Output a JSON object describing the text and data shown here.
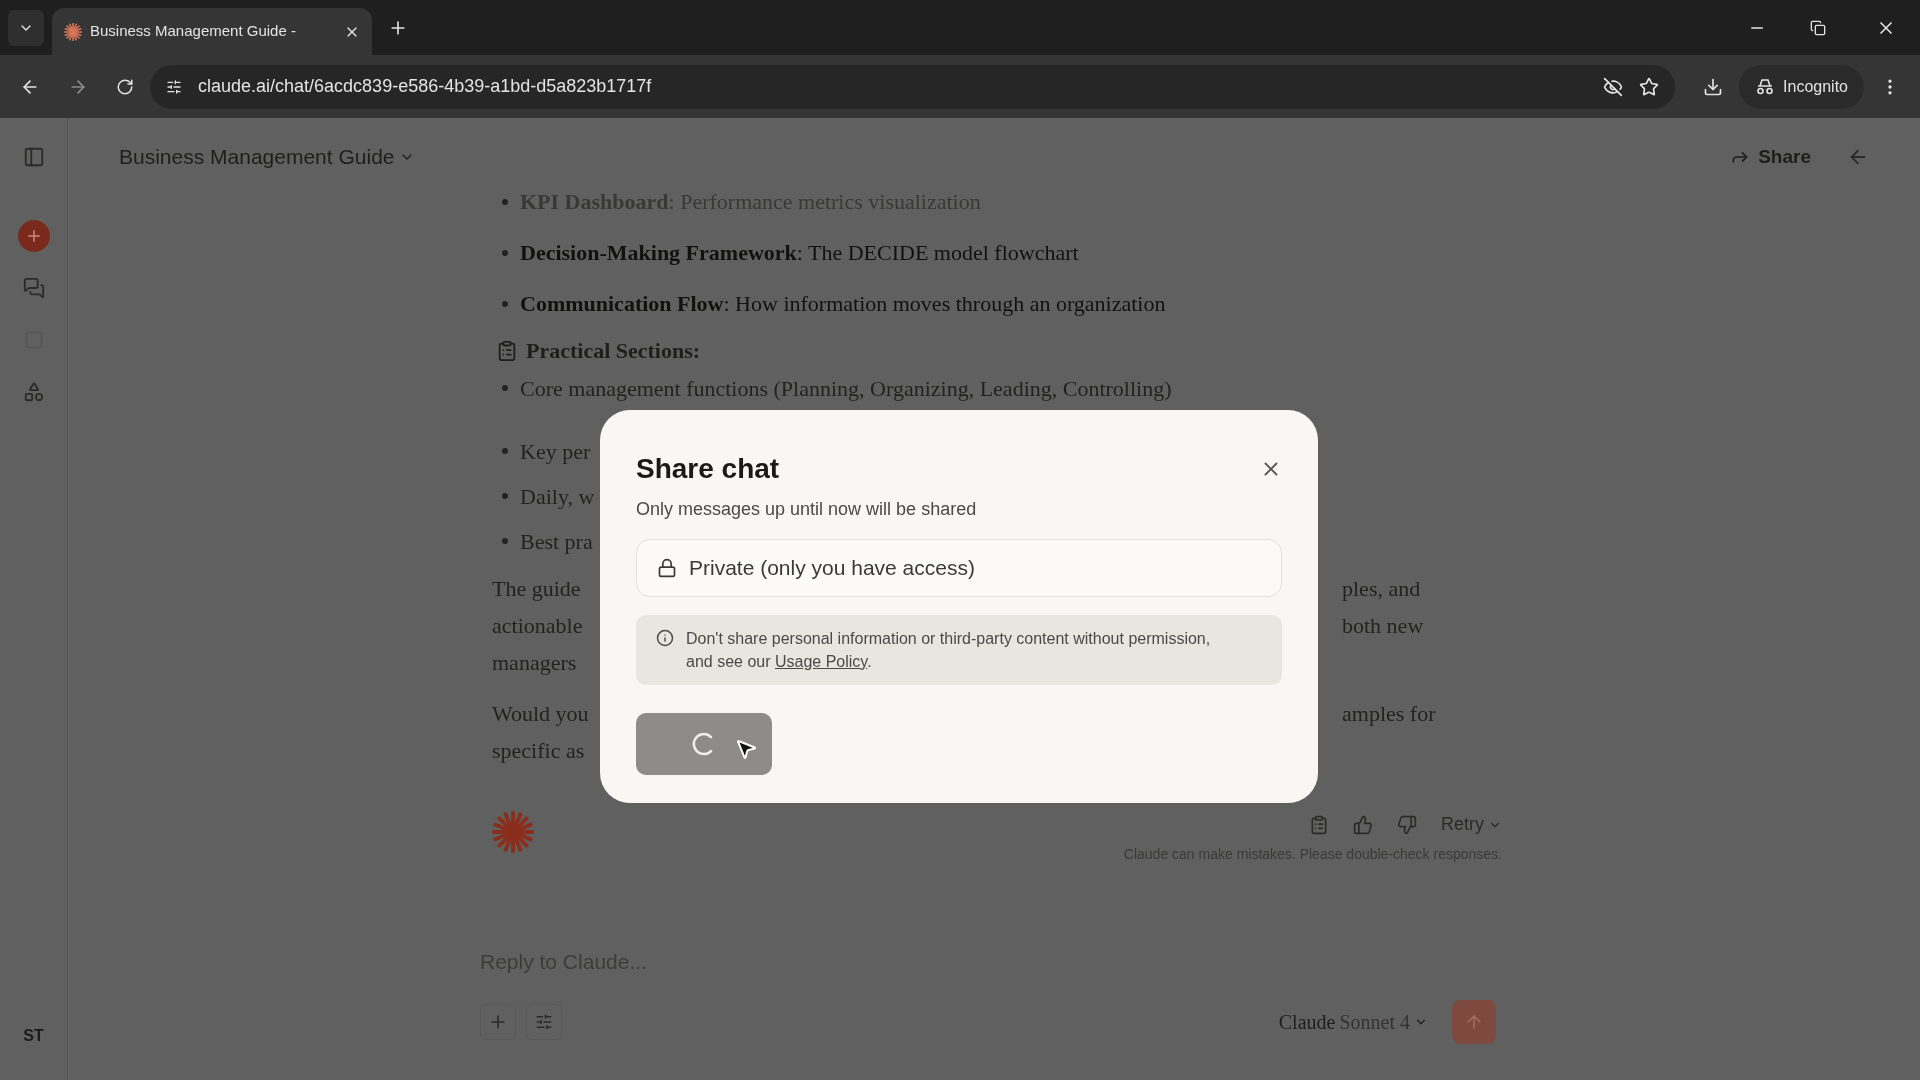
{
  "browser": {
    "tab_title": "Business Management Guide -",
    "url": "claude.ai/chat/6acdc839-e586-4b39-a1bd-d5a823b1717f",
    "profile": "Incognito"
  },
  "header": {
    "title": "Business Management Guide",
    "share": "Share"
  },
  "sidebar": {
    "avatar": "ST"
  },
  "message": {
    "bullets": [
      {
        "bold": "KPI Dashboard",
        "text": ": Performance metrics visualization",
        "faded": true
      },
      {
        "bold": "Decision-Making Framework",
        "text": ": The DECIDE model flowchart",
        "faded": false
      },
      {
        "bold": "Communication Flow",
        "text": ": How information moves through an organization",
        "faded": false
      }
    ],
    "heading": "Practical Sections:",
    "practical_items": [
      {
        "left": "Core management functions (Planning, Organizing, Leading, Controlling)"
      },
      {
        "left": "Key per"
      },
      {
        "left": "Daily, w"
      },
      {
        "left": "Best pra"
      }
    ],
    "paragraphs": [
      {
        "lines": [
          {
            "left": "The guide",
            "right": "ples, and"
          },
          {
            "left": "actionable",
            "right": "both new"
          },
          {
            "left": "managers"
          }
        ]
      },
      {
        "lines": [
          {
            "left": "Would you",
            "right": "amples for"
          },
          {
            "left": "specific as"
          }
        ]
      }
    ],
    "retry": "Retry",
    "disclaimer": "Claude can make mistakes. Please double-check responses."
  },
  "composer": {
    "placeholder": "Reply to Claude...",
    "model_brand": "Claude",
    "model_name": "Sonnet 4"
  },
  "modal": {
    "title": "Share chat",
    "subtitle": "Only messages up until now will be shared",
    "visibility": "Private (only you have access)",
    "notice": {
      "before": "Don't share personal information or third-party content without permission, and see our ",
      "link": "Usage Policy",
      "after": "."
    },
    "button_loading": true
  }
}
